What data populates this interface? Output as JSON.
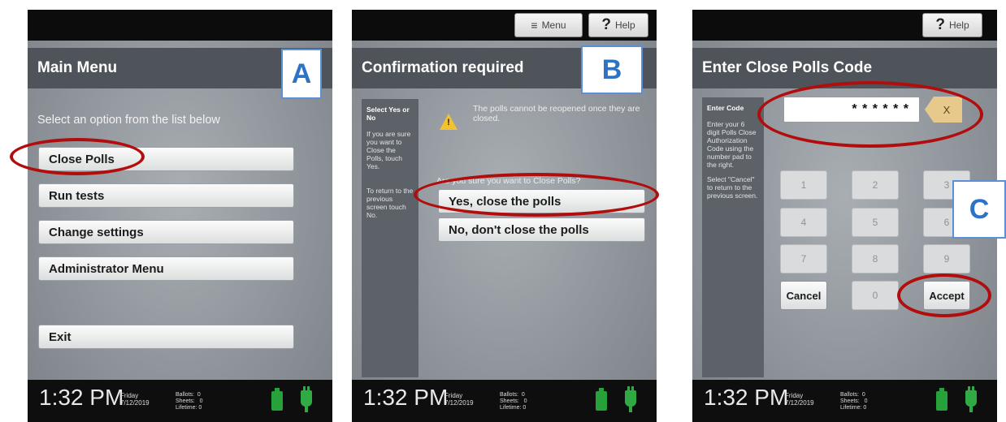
{
  "footer": {
    "time": "1:32 PM",
    "day": "Friday",
    "date": "7/12/2019",
    "stats": "Ballots:  0\nSheets:   0\nLifetime: 0"
  },
  "panelA": {
    "tag": "A",
    "title": "Main Menu",
    "instruction": "Select an option from the list below",
    "buttons": [
      "Close Polls",
      "Run tests",
      "Change settings",
      "Administrator Menu"
    ],
    "exit": "Exit"
  },
  "panelB": {
    "tag": "B",
    "title": "Confirmation required",
    "menu": "Menu",
    "help": "Help",
    "side_title": "Select Yes or No",
    "side_text": "If you are sure you want to Close the Polls, touch Yes.",
    "side_text2": "To return to the previous screen touch No.",
    "warning": "The polls cannot be reopened once they are closed.",
    "question": "Are you sure you want to Close Polls?",
    "yes": "Yes, close the polls",
    "no": "No, don't close the polls"
  },
  "panelC": {
    "tag": "C",
    "title": "Enter Close Polls Code",
    "help": "Help",
    "side_title": "Enter Code",
    "side_text": "Enter your 6 digit Polls Close Authorization Code using the number pad to the right.",
    "side_text2": "Select \"Cancel\" to return to the previous screen.",
    "code": "* * * * * *",
    "clear": "X",
    "keys": [
      "1",
      "2",
      "3",
      "4",
      "5",
      "6",
      "7",
      "8",
      "9"
    ],
    "cancel": "Cancel",
    "zero": "0",
    "accept": "Accept"
  },
  "colors": {
    "annotation_ring": "#b20d0d",
    "tag_text": "#2c72c6",
    "battery": "#27a23a"
  }
}
